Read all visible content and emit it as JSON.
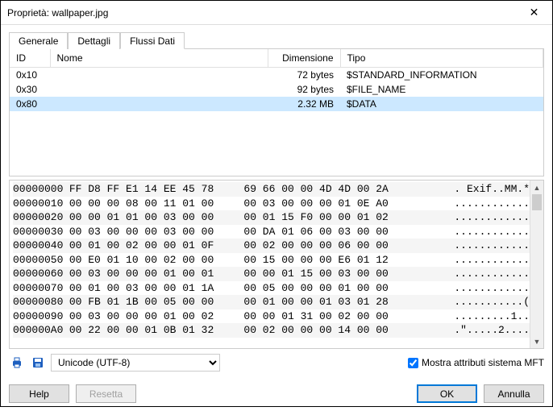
{
  "window": {
    "title": "Proprietà: wallpaper.jpg"
  },
  "tabs": {
    "t0": "Generale",
    "t1": "Dettagli",
    "t2": "Flussi Dati"
  },
  "cols": {
    "id": "ID",
    "name": "Nome",
    "size": "Dimensione",
    "type": "Tipo"
  },
  "rows": [
    {
      "id": "0x10",
      "name": "",
      "size": "72 bytes",
      "type": "$STANDARD_INFORMATION"
    },
    {
      "id": "0x30",
      "name": "",
      "size": "92 bytes",
      "type": "$FILE_NAME"
    },
    {
      "id": "0x80",
      "name": "",
      "size": "2.32 MB",
      "type": "$DATA"
    }
  ],
  "hex": [
    {
      "o": "00000000",
      "a": "FF D8 FF E1 14 EE 45 78",
      "b": "69 66 00 00 4D 4D 00 2A",
      "s": "     . Exif..MM.*"
    },
    {
      "o": "00000010",
      "a": "00 00 00 08 00 11 01 00",
      "b": "00 03 00 00 00 01 0E A0",
      "s": "     ............"
    },
    {
      "o": "00000020",
      "a": "00 00 01 01 00 03 00 00",
      "b": "00 01 15 F0 00 00 01 02",
      "s": "     ............"
    },
    {
      "o": "00000030",
      "a": "00 03 00 00 00 03 00 00",
      "b": "00 DA 01 06 00 03 00 00",
      "s": "     ............"
    },
    {
      "o": "00000040",
      "a": "00 01 00 02 00 00 01 0F",
      "b": "00 02 00 00 00 06 00 00",
      "s": "     ............"
    },
    {
      "o": "00000050",
      "a": "00 E0 01 10 00 02 00 00",
      "b": "00 15 00 00 00 E6 01 12",
      "s": "     ............"
    },
    {
      "o": "00000060",
      "a": "00 03 00 00 00 01 00 01",
      "b": "00 00 01 15 00 03 00 00",
      "s": "     ............"
    },
    {
      "o": "00000070",
      "a": "00 01 00 03 00 00 01 1A",
      "b": "00 05 00 00 00 01 00 00",
      "s": "     ............"
    },
    {
      "o": "00000080",
      "a": "00 FB 01 1B 00 05 00 00",
      "b": "00 01 00 00 01 03 01 28",
      "s": "     ...........("
    },
    {
      "o": "00000090",
      "a": "00 03 00 00 00 01 00 02",
      "b": "00 00 01 31 00 02 00 00",
      "s": "     .........1.."
    },
    {
      "o": "000000A0",
      "a": "00 22 00 00 01 0B 01 32",
      "b": "00 02 00 00 00 14 00 00",
      "s": "     .\".....2...."
    }
  ],
  "encoding": {
    "selected": "Unicode (UTF-8)"
  },
  "checkbox": {
    "label": "Mostra attributi sistema MFT"
  },
  "buttons": {
    "help": "Help",
    "reset": "Resetta",
    "ok": "OK",
    "cancel": "Annulla"
  }
}
